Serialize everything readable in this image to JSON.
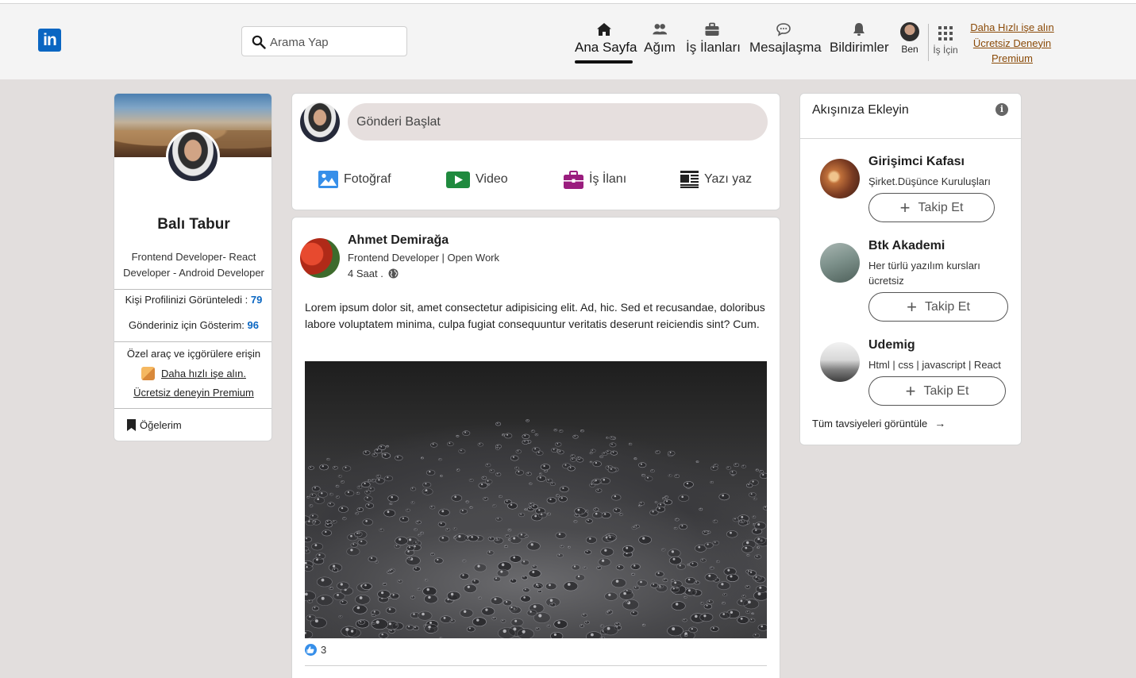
{
  "header": {
    "logo_text": "in",
    "search_placeholder": "Arama Yap",
    "nav": [
      {
        "label": "Ana Sayfa",
        "icon": "home-icon",
        "active": true
      },
      {
        "label": "Ağım",
        "icon": "network-icon"
      },
      {
        "label": "İş İlanları",
        "icon": "briefcase-icon"
      },
      {
        "label": "Mesajlaşma",
        "icon": "message-icon"
      },
      {
        "label": "Bildirimler",
        "icon": "bell-icon"
      }
    ],
    "me_label": "Ben",
    "work_label": "İş İçin",
    "promo_lines": [
      "Daha Hızlı işe alın",
      "Ücretsiz Deneyin",
      "Premium"
    ],
    "promo_color": "#8a4a08",
    "brand_color": "#0a66c2"
  },
  "profile": {
    "name": "Balı Tabur",
    "title": "Frontend Developer- React Developer - Android Developer",
    "views_label": "Kişi Profilinizi Görünteledi : ",
    "views_count": "79",
    "impressions_label": "Gönderiniz için Gösterim: ",
    "impressions_count": "96",
    "premium_intro": "Özel araç ve içgörülere erişin",
    "premium_link1": "Daha hızlı işe alın.",
    "premium_link2": "Ücretsiz deneyin Premium",
    "items_label": "Öğelerim"
  },
  "start_post": {
    "placeholder": "Gönderi Başlat",
    "actions": [
      {
        "label": "Fotoğraf",
        "icon": "photo-icon",
        "color": "#378fe9"
      },
      {
        "label": "Video",
        "icon": "video-icon",
        "color": "#5f9b41"
      },
      {
        "label": "İş İlanı",
        "icon": "job-icon",
        "color": "#a8237a"
      },
      {
        "label": "Yazı yaz",
        "icon": "article-icon",
        "color": "#222222"
      }
    ]
  },
  "post": {
    "author": "Ahmet Demirağa",
    "subtitle": "Frontend Developer | Open Work",
    "time": "4 Saat .",
    "text": "Lorem ipsum dolor sit, amet consectetur adipisicing elit. Ad, hic. Sed et recusandae, doloribus labore voluptatem minima, culpa fugiat consequuntur veritatis deserunt reiciendis sint? Cum.",
    "likes": "3"
  },
  "feed": {
    "title": "Akışınıza Ekleyin",
    "recommendations": [
      {
        "name": "Girişimci Kafası",
        "desc": "Şirket.Düşünce Kuruluşları",
        "button": "Takip Et"
      },
      {
        "name": "Btk Akademi",
        "desc": "Her türlü yazılım kursları ücretsiz",
        "button": "Takip Et"
      },
      {
        "name": "Udemig",
        "desc": "Html | css | javascript | React",
        "button": "Takip Et"
      }
    ],
    "see_all": "Tüm tavsiyeleri görüntüle"
  }
}
